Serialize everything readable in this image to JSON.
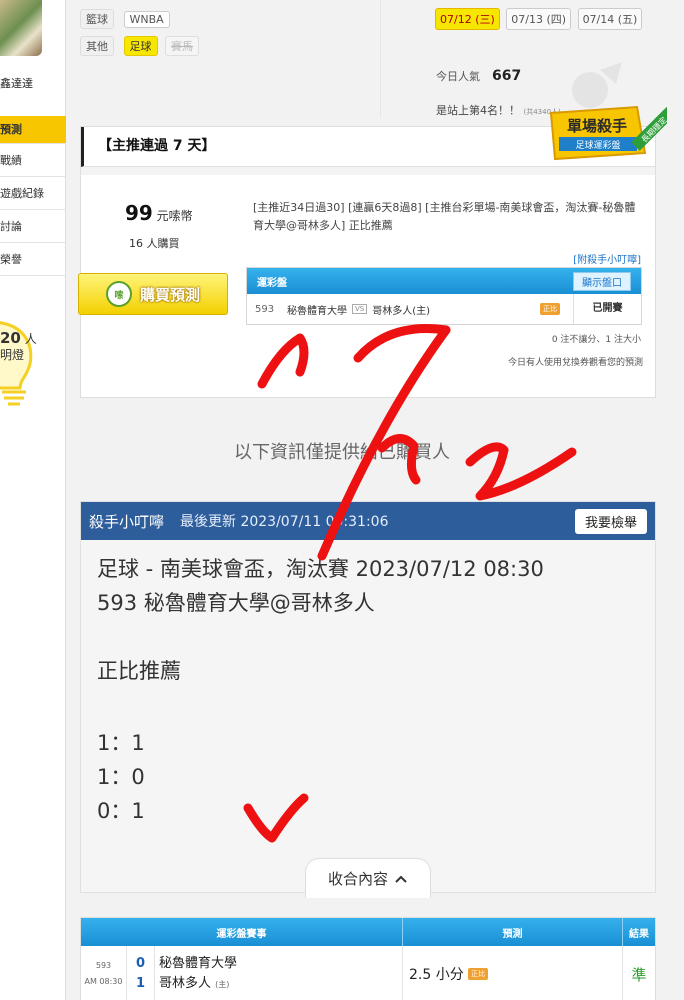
{
  "sidebar": {
    "username": "鑫達達",
    "items": [
      "預測",
      "戰績",
      "遊戲紀錄",
      "討論",
      "榮譽"
    ],
    "bulb_count": "20",
    "bulb_unit": "人",
    "bulb_text": "明燈"
  },
  "tags": {
    "row1_label": "籃球",
    "row1_items": [
      "WNBA"
    ],
    "row2_label": "其他",
    "row2_items": [
      "足球",
      "賽馬"
    ]
  },
  "dates": [
    "07/12 (三)",
    "07/13 (四)",
    "07/14 (五)"
  ],
  "stats": {
    "pop_label": "今日人氣",
    "pop_value": "667",
    "rank_text": "是站上第4名！！",
    "rank_small": "(共4340人)"
  },
  "card": {
    "title": "【主推連過 7 天】",
    "badge_title": "單場殺手",
    "badge_sub": "足球運彩盤",
    "badge_ribbon": "長期穩定",
    "price_value": "99",
    "price_unit": "元嗦幣",
    "buyers": "16 人購買",
    "buy_label": "購買預測",
    "buy_icon": "嗦",
    "streak_text": "[主推近34日過30] [連贏6天8過8] [主推台彩單場-南美球會盃，淘汰賽-秘魯體育大學@哥林多人] 正比推薦",
    "addon_link": "[附殺手小叮嚀]",
    "table_head": "運彩盤",
    "show_button": "顯示盤口",
    "row": {
      "num": "593",
      "away": "秘魯體育大學",
      "vs": "VS",
      "home": "哥林多人(主)",
      "pill": "正比",
      "status": "已開賽"
    },
    "note1": "0 注不讓分、1 注大小",
    "note2": "今日有人使用兌換券觀看您的預測"
  },
  "info_only": "以下資訊僅提供給已購買人",
  "killer": {
    "title": "殺手小叮嚀",
    "updated": "最後更新 2023/07/11 09:31:06",
    "report_button": "我要檢舉",
    "lines": [
      "足球 - 南美球會盃，淘汰賽 2023/07/12 08:30",
      "593 秘魯體育大學@哥林多人",
      "",
      "正比推薦",
      "",
      "1：1",
      "1：0",
      "0：1"
    ],
    "collapse": "收合內容"
  },
  "bottom_table": {
    "headers": [
      "運彩盤賽事",
      "預測",
      "結果"
    ],
    "num": "593",
    "time": "AM 08:30",
    "score_away": "0",
    "score_home": "1",
    "team_away": "秘魯體育大學",
    "team_home": "哥林多人",
    "home_mark": "(主)",
    "prediction": "2.5 小分",
    "pill": "正比",
    "result": "準"
  },
  "handwriting": "7/12 ✓"
}
